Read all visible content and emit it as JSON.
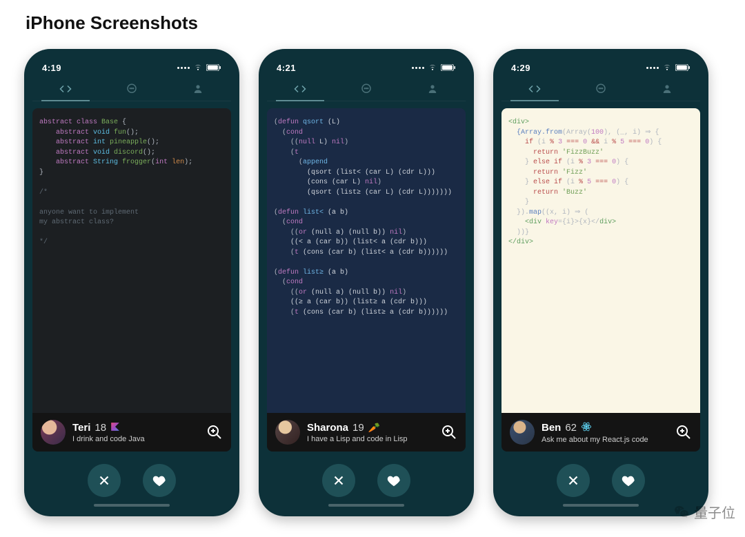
{
  "section_title": "iPhone Screenshots",
  "watermark_text": "量子位",
  "screens": [
    {
      "time": "4:19",
      "code_lines": [
        {
          "segs": [
            {
              "t": "abstract class ",
              "c": "kw"
            },
            {
              "t": "Base ",
              "c": "ident"
            },
            {
              "t": "{",
              "c": "punct"
            }
          ]
        },
        {
          "segs": [
            {
              "t": "    abstract ",
              "c": "kw"
            },
            {
              "t": "void ",
              "c": "rettype"
            },
            {
              "t": "fun",
              "c": "ident"
            },
            {
              "t": "();",
              "c": "punct"
            }
          ]
        },
        {
          "segs": [
            {
              "t": "    abstract ",
              "c": "kw"
            },
            {
              "t": "int ",
              "c": "rettype"
            },
            {
              "t": "pineapple",
              "c": "ident"
            },
            {
              "t": "();",
              "c": "punct"
            }
          ]
        },
        {
          "segs": [
            {
              "t": "    abstract ",
              "c": "kw"
            },
            {
              "t": "void ",
              "c": "rettype"
            },
            {
              "t": "discord",
              "c": "ident"
            },
            {
              "t": "();",
              "c": "punct"
            }
          ]
        },
        {
          "segs": [
            {
              "t": "    abstract ",
              "c": "kw"
            },
            {
              "t": "String ",
              "c": "rettype"
            },
            {
              "t": "frogger",
              "c": "ident"
            },
            {
              "t": "(",
              "c": "punct"
            },
            {
              "t": "int ",
              "c": "param-ty"
            },
            {
              "t": "len",
              "c": "param-nm"
            },
            {
              "t": ");",
              "c": "punct"
            }
          ]
        },
        {
          "segs": [
            {
              "t": "}",
              "c": "punct"
            }
          ]
        },
        {
          "segs": [
            {
              "t": "",
              "c": ""
            }
          ]
        },
        {
          "segs": [
            {
              "t": "/*",
              "c": "comment"
            }
          ]
        },
        {
          "segs": [
            {
              "t": "",
              "c": ""
            }
          ]
        },
        {
          "segs": [
            {
              "t": "anyone want to implement",
              "c": "comment"
            }
          ]
        },
        {
          "segs": [
            {
              "t": "my abstract class?",
              "c": "comment"
            }
          ]
        },
        {
          "segs": [
            {
              "t": "",
              "c": ""
            }
          ]
        },
        {
          "segs": [
            {
              "t": "*/",
              "c": "comment"
            }
          ]
        }
      ],
      "profile": {
        "name": "Teri",
        "age": "18",
        "tech_icon": "kotlin",
        "bio": "I drink and code Java"
      }
    },
    {
      "time": "4:21",
      "code_lines": [
        {
          "segs": [
            {
              "t": "(",
              "c": "punct"
            },
            {
              "t": "defun ",
              "c": "lsp-def"
            },
            {
              "t": "qsort ",
              "c": "lsp-fn"
            },
            {
              "t": "(L)",
              "c": "lsp-sym"
            }
          ]
        },
        {
          "segs": [
            {
              "t": "  (",
              "c": "punct"
            },
            {
              "t": "cond",
              "c": "lsp-def"
            }
          ]
        },
        {
          "segs": [
            {
              "t": "    ((",
              "c": "punct"
            },
            {
              "t": "null ",
              "c": "lsp-def"
            },
            {
              "t": "L) ",
              "c": "lsp-sym"
            },
            {
              "t": "nil",
              "c": "lsp-nil"
            },
            {
              "t": ")",
              "c": "punct"
            }
          ]
        },
        {
          "segs": [
            {
              "t": "    (",
              "c": "punct"
            },
            {
              "t": "t",
              "c": "lsp-def"
            }
          ]
        },
        {
          "segs": [
            {
              "t": "      (",
              "c": "punct"
            },
            {
              "t": "append",
              "c": "lsp-fn"
            }
          ]
        },
        {
          "segs": [
            {
              "t": "        (qsort (list< (car L) (cdr L)))",
              "c": "lsp-sym"
            }
          ]
        },
        {
          "segs": [
            {
              "t": "        (cons (car L) ",
              "c": "lsp-sym"
            },
            {
              "t": "nil",
              "c": "lsp-nil"
            },
            {
              "t": ")",
              "c": "punct"
            }
          ]
        },
        {
          "segs": [
            {
              "t": "        (qsort (list≥ (car L) (cdr L)))))))",
              "c": "lsp-sym"
            }
          ]
        },
        {
          "segs": [
            {
              "t": "",
              "c": ""
            }
          ]
        },
        {
          "segs": [
            {
              "t": "(",
              "c": "punct"
            },
            {
              "t": "defun ",
              "c": "lsp-def"
            },
            {
              "t": "list< ",
              "c": "lsp-fn"
            },
            {
              "t": "(a b)",
              "c": "lsp-sym"
            }
          ]
        },
        {
          "segs": [
            {
              "t": "  (",
              "c": "punct"
            },
            {
              "t": "cond",
              "c": "lsp-def"
            }
          ]
        },
        {
          "segs": [
            {
              "t": "    ((",
              "c": "punct"
            },
            {
              "t": "or ",
              "c": "lsp-def"
            },
            {
              "t": "(null a) (null b)) ",
              "c": "lsp-sym"
            },
            {
              "t": "nil",
              "c": "lsp-nil"
            },
            {
              "t": ")",
              "c": "punct"
            }
          ]
        },
        {
          "segs": [
            {
              "t": "    ((< a (car b)) (list< a (cdr b)))",
              "c": "lsp-sym"
            }
          ]
        },
        {
          "segs": [
            {
              "t": "    (",
              "c": "punct"
            },
            {
              "t": "t ",
              "c": "lsp-def"
            },
            {
              "t": "(cons (car b) (list< a (cdr b))))))",
              "c": "lsp-sym"
            }
          ]
        },
        {
          "segs": [
            {
              "t": "",
              "c": ""
            }
          ]
        },
        {
          "segs": [
            {
              "t": "(",
              "c": "punct"
            },
            {
              "t": "defun ",
              "c": "lsp-def"
            },
            {
              "t": "list≥ ",
              "c": "lsp-fn"
            },
            {
              "t": "(a b)",
              "c": "lsp-sym"
            }
          ]
        },
        {
          "segs": [
            {
              "t": "  (",
              "c": "punct"
            },
            {
              "t": "cond",
              "c": "lsp-def"
            }
          ]
        },
        {
          "segs": [
            {
              "t": "    ((",
              "c": "punct"
            },
            {
              "t": "or ",
              "c": "lsp-def"
            },
            {
              "t": "(null a) (null b)) ",
              "c": "lsp-sym"
            },
            {
              "t": "nil",
              "c": "lsp-nil"
            },
            {
              "t": ")",
              "c": "punct"
            }
          ]
        },
        {
          "segs": [
            {
              "t": "    ((≥ a (car b)) (list≥ a (cdr b)))",
              "c": "lsp-sym"
            }
          ]
        },
        {
          "segs": [
            {
              "t": "    (",
              "c": "punct"
            },
            {
              "t": "t ",
              "c": "lsp-def"
            },
            {
              "t": "(cons (car b) (list≥ a (cdr b))))))",
              "c": "lsp-sym"
            }
          ]
        }
      ],
      "profile": {
        "name": "Sharona",
        "age": "19",
        "tech_icon": "carrot",
        "bio": "I have a Lisp and code in Lisp"
      }
    },
    {
      "time": "4:29",
      "code_lines": [
        {
          "segs": [
            {
              "t": "<",
              "c": "jsx-tag"
            },
            {
              "t": "div",
              "c": "jsx-tag"
            },
            {
              "t": ">",
              "c": "jsx-tag"
            }
          ]
        },
        {
          "segs": [
            {
              "t": "  {Array.",
              "c": "jsx-var"
            },
            {
              "t": "from",
              "c": "jsx-var"
            },
            {
              "t": "(Array(",
              "c": "punct"
            },
            {
              "t": "100",
              "c": "jsx-num"
            },
            {
              "t": "), (_, i) ⇒ {",
              "c": "punct"
            }
          ]
        },
        {
          "segs": [
            {
              "t": "    ",
              "c": ""
            },
            {
              "t": "if ",
              "c": "jsx-kw"
            },
            {
              "t": "(i ",
              "c": "punct"
            },
            {
              "t": "% ",
              "c": "jsx-op"
            },
            {
              "t": "3 ",
              "c": "jsx-num"
            },
            {
              "t": "=== ",
              "c": "jsx-op"
            },
            {
              "t": "0 ",
              "c": "jsx-num"
            },
            {
              "t": "&& ",
              "c": "jsx-op"
            },
            {
              "t": "i ",
              "c": "punct"
            },
            {
              "t": "% ",
              "c": "jsx-op"
            },
            {
              "t": "5 ",
              "c": "jsx-num"
            },
            {
              "t": "=== ",
              "c": "jsx-op"
            },
            {
              "t": "0",
              "c": "jsx-num"
            },
            {
              "t": ") {",
              "c": "punct"
            }
          ]
        },
        {
          "segs": [
            {
              "t": "      ",
              "c": ""
            },
            {
              "t": "return ",
              "c": "jsx-ret"
            },
            {
              "t": "'FizzBuzz'",
              "c": "jsx-str"
            }
          ]
        },
        {
          "segs": [
            {
              "t": "    } ",
              "c": "punct"
            },
            {
              "t": "else if ",
              "c": "jsx-kw"
            },
            {
              "t": "(i ",
              "c": "punct"
            },
            {
              "t": "% ",
              "c": "jsx-op"
            },
            {
              "t": "3 ",
              "c": "jsx-num"
            },
            {
              "t": "=== ",
              "c": "jsx-op"
            },
            {
              "t": "0",
              "c": "jsx-num"
            },
            {
              "t": ") {",
              "c": "punct"
            }
          ]
        },
        {
          "segs": [
            {
              "t": "      ",
              "c": ""
            },
            {
              "t": "return ",
              "c": "jsx-ret"
            },
            {
              "t": "'Fizz'",
              "c": "jsx-str"
            }
          ]
        },
        {
          "segs": [
            {
              "t": "    } ",
              "c": "punct"
            },
            {
              "t": "else if ",
              "c": "jsx-kw"
            },
            {
              "t": "(i ",
              "c": "punct"
            },
            {
              "t": "% ",
              "c": "jsx-op"
            },
            {
              "t": "5 ",
              "c": "jsx-num"
            },
            {
              "t": "=== ",
              "c": "jsx-op"
            },
            {
              "t": "0",
              "c": "jsx-num"
            },
            {
              "t": ") {",
              "c": "punct"
            }
          ]
        },
        {
          "segs": [
            {
              "t": "      ",
              "c": ""
            },
            {
              "t": "return ",
              "c": "jsx-ret"
            },
            {
              "t": "'Buzz'",
              "c": "jsx-str"
            }
          ]
        },
        {
          "segs": [
            {
              "t": "    }",
              "c": "punct"
            }
          ]
        },
        {
          "segs": [
            {
              "t": "  }).",
              "c": "punct"
            },
            {
              "t": "map",
              "c": "jsx-var"
            },
            {
              "t": "((x, i) ⇒ (",
              "c": "punct"
            }
          ]
        },
        {
          "segs": [
            {
              "t": "    <",
              "c": "jsx-tag"
            },
            {
              "t": "div ",
              "c": "jsx-tag"
            },
            {
              "t": "key",
              "c": "jsx-attr"
            },
            {
              "t": "={i}>{x}</",
              "c": "punct"
            },
            {
              "t": "div",
              "c": "jsx-tag"
            },
            {
              "t": ">",
              "c": "jsx-tag"
            }
          ]
        },
        {
          "segs": [
            {
              "t": "  ))}",
              "c": "punct"
            }
          ]
        },
        {
          "segs": [
            {
              "t": "</",
              "c": "jsx-tag"
            },
            {
              "t": "div",
              "c": "jsx-tag"
            },
            {
              "t": ">",
              "c": "jsx-tag"
            }
          ]
        }
      ],
      "profile": {
        "name": "Ben",
        "age": "62",
        "tech_icon": "react",
        "bio": "Ask me about my React.js code"
      }
    }
  ]
}
